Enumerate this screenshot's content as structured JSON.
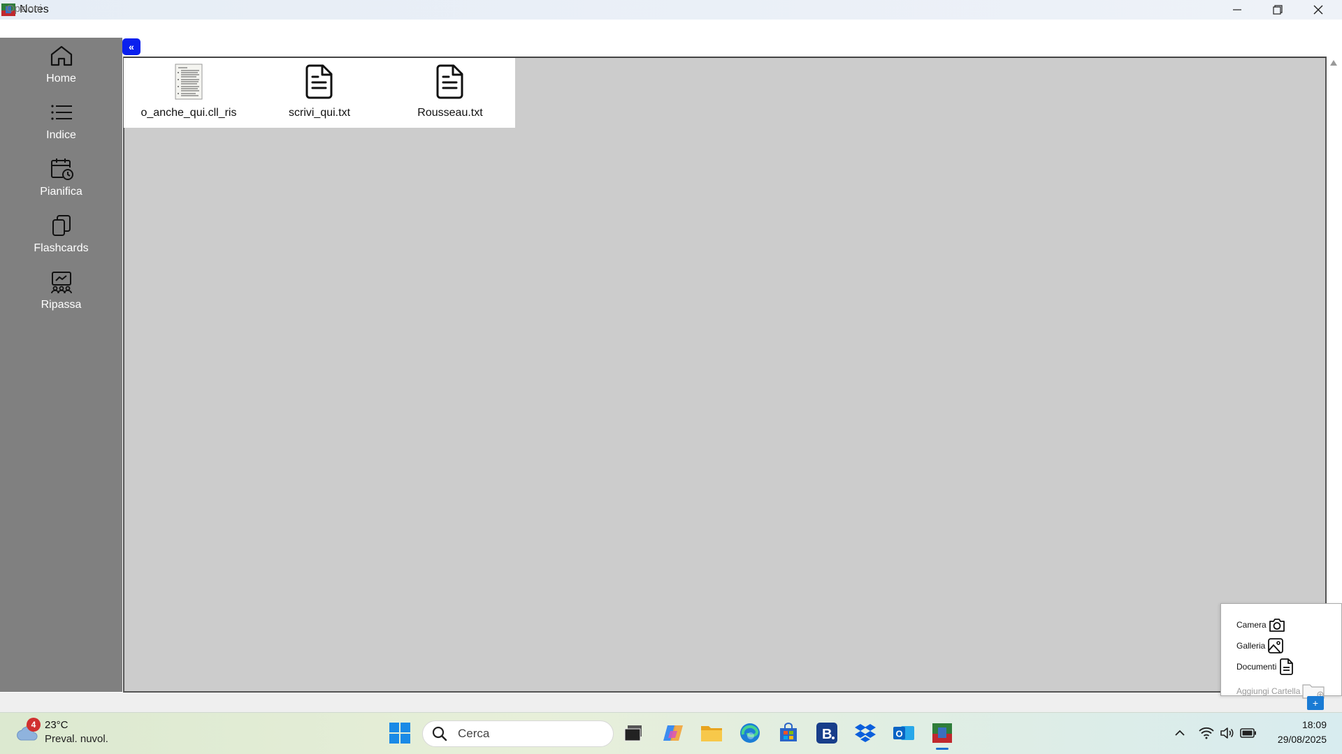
{
  "window": {
    "title": "Notes"
  },
  "menu": {
    "options": "Opzioni"
  },
  "sidebar": {
    "items": [
      {
        "label": "Home",
        "icon": "home-icon"
      },
      {
        "label": "Indice",
        "icon": "list-icon"
      },
      {
        "label": "Pianifica",
        "icon": "calendar-clock-icon"
      },
      {
        "label": "Flashcards",
        "icon": "cards-icon"
      },
      {
        "label": "Ripassa",
        "icon": "presentation-icon"
      }
    ]
  },
  "collapse_button": "«",
  "files": [
    {
      "name": "o_anche_qui.cll_ris",
      "icon": "document-thumbnail-icon"
    },
    {
      "name": "scrivi_qui.txt",
      "icon": "text-file-icon"
    },
    {
      "name": "Rousseau.txt",
      "icon": "text-file-icon"
    }
  ],
  "popup": {
    "camera": "Camera",
    "gallery": "Galleria",
    "documents": "Documenti",
    "add_folder": "Aggiungi Cartella"
  },
  "add_button": "+",
  "taskbar": {
    "weather_badge": "4",
    "temperature": "23°C",
    "weather_desc": "Preval. nuvol.",
    "search_placeholder": "Cerca",
    "time": "18:09",
    "date": "29/08/2025"
  },
  "colors": {
    "sidebar_bg": "#808080",
    "content_bg": "#cccccc",
    "accent_blue": "#0a20ee",
    "add_button": "#1a7bd4"
  }
}
